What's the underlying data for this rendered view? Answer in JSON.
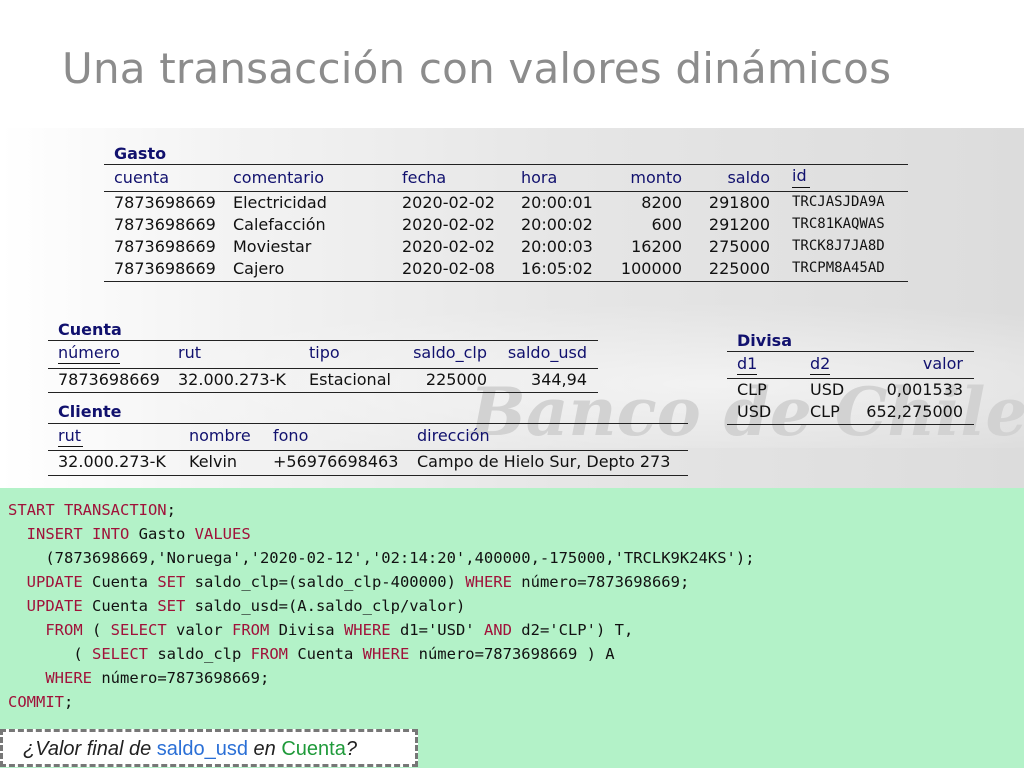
{
  "slide": {
    "title": "Una transacción con valores dinámicos"
  },
  "watermark": "Banco de Chile",
  "gasto": {
    "caption": "Gasto",
    "headers": [
      "cuenta",
      "comentario",
      "fecha",
      "hora",
      "monto",
      "saldo",
      "id"
    ],
    "rows": [
      [
        "7873698669",
        "Electricidad",
        "2020-02-02",
        "20:00:01",
        "8200",
        "291800",
        "TRCJASJDA9A"
      ],
      [
        "7873698669",
        "Calefacción",
        "2020-02-02",
        "20:00:02",
        "600",
        "291200",
        "TRC81KAQWAS"
      ],
      [
        "7873698669",
        "Moviestar",
        "2020-02-02",
        "20:00:03",
        "16200",
        "275000",
        "TRCK8J7JA8D"
      ],
      [
        "7873698669",
        "Cajero",
        "2020-02-08",
        "16:05:02",
        "100000",
        "225000",
        "TRCPM8A45AD"
      ]
    ]
  },
  "cuenta": {
    "caption": "Cuenta",
    "headers": [
      "número",
      "rut",
      "tipo",
      "saldo_clp",
      "saldo_usd"
    ],
    "rows": [
      [
        "7873698669",
        "32.000.273-K",
        "Estacional",
        "225000",
        "344,94"
      ]
    ]
  },
  "cliente": {
    "caption": "Cliente",
    "headers": [
      "rut",
      "nombre",
      "fono",
      "dirección"
    ],
    "rows": [
      [
        "32.000.273-K",
        "Kelvin",
        "+56976698463",
        "Campo de Hielo Sur, Depto 273"
      ]
    ]
  },
  "divisa": {
    "caption": "Divisa",
    "headers": [
      "d1",
      "d2",
      "valor"
    ],
    "rows": [
      [
        "CLP",
        "USD",
        "0,001533"
      ],
      [
        "USD",
        "CLP",
        "652,275000"
      ]
    ]
  },
  "code": {
    "lines": [
      [
        [
          "kw",
          "START TRANSACTION"
        ],
        [
          "t",
          ";"
        ]
      ],
      [
        [
          "t",
          "  "
        ],
        [
          "kw",
          "INSERT INTO"
        ],
        [
          "t",
          " Gasto "
        ],
        [
          "kw",
          "VALUES"
        ]
      ],
      [
        [
          "t",
          "    (7873698669,'Noruega','2020-02-12','02:14:20',400000,-175000,'TRCLK9K24KS');"
        ]
      ],
      [
        [
          "t",
          "  "
        ],
        [
          "kw",
          "UPDATE"
        ],
        [
          "t",
          " Cuenta "
        ],
        [
          "kw",
          "SET"
        ],
        [
          "t",
          " saldo_clp=(saldo_clp-400000) "
        ],
        [
          "kw",
          "WHERE"
        ],
        [
          "t",
          " número=7873698669;"
        ]
      ],
      [
        [
          "t",
          "  "
        ],
        [
          "kw",
          "UPDATE"
        ],
        [
          "t",
          " Cuenta "
        ],
        [
          "kw",
          "SET"
        ],
        [
          "t",
          " saldo_usd=(A.saldo_clp/valor)"
        ]
      ],
      [
        [
          "t",
          "    "
        ],
        [
          "kw",
          "FROM"
        ],
        [
          "t",
          " ( "
        ],
        [
          "kw",
          "SELECT"
        ],
        [
          "t",
          " valor "
        ],
        [
          "kw",
          "FROM"
        ],
        [
          "t",
          " Divisa "
        ],
        [
          "kw",
          "WHERE"
        ],
        [
          "t",
          " d1='USD' "
        ],
        [
          "kw",
          "AND"
        ],
        [
          "t",
          " d2='CLP') T,"
        ]
      ],
      [
        [
          "t",
          "       ( "
        ],
        [
          "kw",
          "SELECT"
        ],
        [
          "t",
          " saldo_clp "
        ],
        [
          "kw",
          "FROM"
        ],
        [
          "t",
          " Cuenta "
        ],
        [
          "kw",
          "WHERE"
        ],
        [
          "t",
          " número=7873698669 ) A"
        ]
      ],
      [
        [
          "t",
          "    "
        ],
        [
          "kw",
          "WHERE"
        ],
        [
          "t",
          " número=7873698669;"
        ]
      ],
      [
        [
          "kw",
          "COMMIT"
        ],
        [
          "t",
          ";"
        ]
      ]
    ]
  },
  "question": {
    "pre": "¿Valor final de ",
    "a": "saldo_usd",
    "mid": " en ",
    "b": "Cuenta",
    "post": "?"
  },
  "colors": {
    "title": "#8c8c8c",
    "header": "#11116e",
    "keyword": "#a0123a",
    "codebg": "#b3f2c8"
  }
}
